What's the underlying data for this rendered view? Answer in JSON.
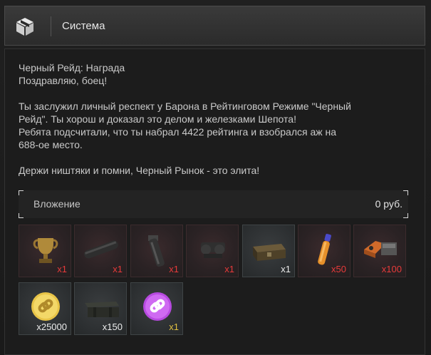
{
  "header": {
    "title": "Система",
    "icon": "box-icon"
  },
  "message": {
    "lines": [
      "Черный Рейд: Награда",
      "Поздравляю, боец!",
      "",
      "Ты заслужил личный респект у Барона в Рейтинговом Режиме \"Черный",
      "Рейд\". Ты хорош и доказал это делом и железками Шепота!",
      "Ребята подсчитали, что ты набрал 4422 рейтинга и взобрался аж на",
      "688-ое место.",
      "",
      "Держи ништяки и помни, Черный Рынок - это элита!"
    ]
  },
  "attachment": {
    "label": "Вложение",
    "amount": "0 руб."
  },
  "items": [
    {
      "icon": "trophy-icon",
      "qty": "x1",
      "tone": "red"
    },
    {
      "icon": "silencer-icon",
      "qty": "x1",
      "tone": "red"
    },
    {
      "icon": "grip-icon",
      "qty": "x1",
      "tone": "red"
    },
    {
      "icon": "scope-mount-icon",
      "qty": "x1",
      "tone": "red"
    },
    {
      "icon": "weapon-case-icon",
      "qty": "x1",
      "tone": "gray"
    },
    {
      "icon": "booster-icon",
      "qty": "x50",
      "tone": "red"
    },
    {
      "icon": "repair-kit-icon",
      "qty": "x100",
      "tone": "red"
    },
    {
      "icon": "gold-link-coin-icon",
      "qty": "x25000",
      "tone": "gray"
    },
    {
      "icon": "crate-icon",
      "qty": "x150",
      "tone": "gray"
    },
    {
      "icon": "purple-link-coin-icon",
      "qty": "x1",
      "tone": "gold"
    }
  ]
}
